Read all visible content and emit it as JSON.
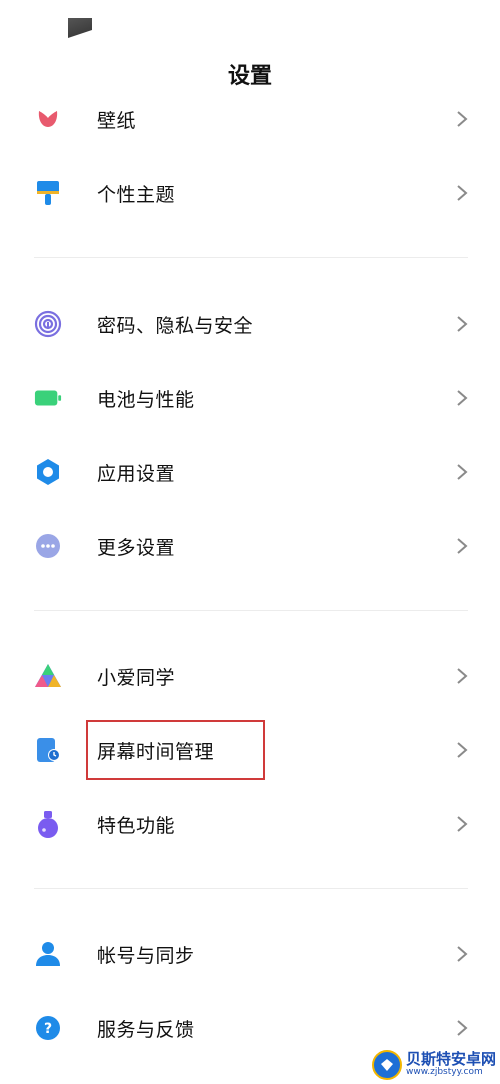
{
  "header": {
    "title": "设置"
  },
  "groups": [
    {
      "items": [
        {
          "label": "壁纸",
          "icon": "wallpaper-icon"
        },
        {
          "label": "个性主题",
          "icon": "theme-brush-icon"
        }
      ]
    },
    {
      "items": [
        {
          "label": "密码、隐私与安全",
          "icon": "fingerprint-icon"
        },
        {
          "label": "电池与性能",
          "icon": "battery-icon"
        },
        {
          "label": "应用设置",
          "icon": "gear-icon"
        },
        {
          "label": "更多设置",
          "icon": "more-dots-icon"
        }
      ]
    },
    {
      "items": [
        {
          "label": "小爱同学",
          "icon": "xiaoai-icon"
        },
        {
          "label": "屏幕时间管理",
          "icon": "screen-time-icon"
        },
        {
          "label": "特色功能",
          "icon": "flask-icon"
        }
      ]
    },
    {
      "items": [
        {
          "label": "帐号与同步",
          "icon": "account-icon"
        },
        {
          "label": "服务与反馈",
          "icon": "help-icon"
        }
      ]
    }
  ],
  "watermark": {
    "title": "贝斯特安卓网",
    "url": "www.zjbstyy.com"
  },
  "colors": {
    "highlight": "#d03a3a",
    "wallpaper": "#e85a6e",
    "theme": "#1f8be8",
    "privacy": "#7a6fe0",
    "battery": "#3ad17a",
    "app_settings": "#1f8be8",
    "more": "#9aa6e6",
    "screen_time": "#3a8fe8",
    "special": "#7a5cf0",
    "account": "#1f8be8",
    "service": "#1f8be8"
  }
}
